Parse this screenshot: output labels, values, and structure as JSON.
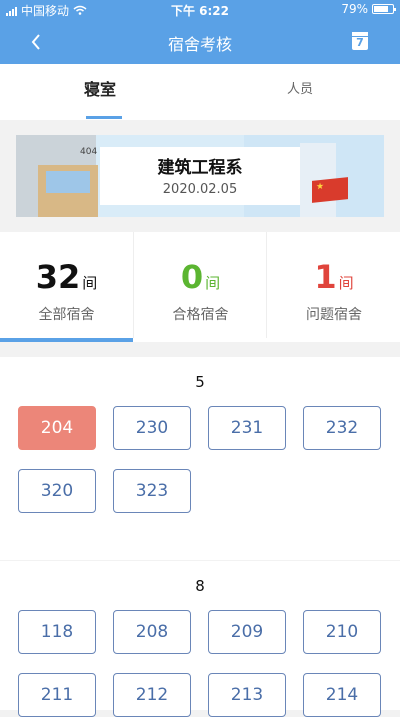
{
  "status_bar": {
    "carrier": "中国移动",
    "time": "下午 6:22",
    "battery": "79%",
    "battery_level": 0.79
  },
  "nav": {
    "title": "宿舍考核",
    "back_icon": "chevron-left-icon",
    "calendar_day": "7"
  },
  "tabs": [
    {
      "label": "寝室",
      "active": true
    },
    {
      "label": "人员",
      "active": false
    }
  ],
  "banner": {
    "department": "建筑工程系",
    "date": "2020.02.05",
    "sign_text": "404"
  },
  "stats": [
    {
      "value": "32",
      "unit": "间",
      "label": "全部宿舍",
      "color": "#111111"
    },
    {
      "value": "0",
      "unit": "间",
      "label": "合格宿舍",
      "color": "#5bb531"
    },
    {
      "value": "1",
      "unit": "间",
      "label": "问题宿舍",
      "color": "#e0443c"
    }
  ],
  "colors": {
    "accent": "#5aa1e6",
    "problem_room": "#ec8679",
    "room_border": "#6a86b8"
  },
  "sections": [
    {
      "title": "5",
      "rooms": [
        {
          "number": "204",
          "status": "problem"
        },
        {
          "number": "230",
          "status": "normal"
        },
        {
          "number": "231",
          "status": "normal"
        },
        {
          "number": "232",
          "status": "normal"
        },
        {
          "number": "320",
          "status": "normal"
        },
        {
          "number": "323",
          "status": "normal"
        }
      ]
    },
    {
      "title": "8",
      "rooms": [
        {
          "number": "118",
          "status": "normal"
        },
        {
          "number": "208",
          "status": "normal"
        },
        {
          "number": "209",
          "status": "normal"
        },
        {
          "number": "210",
          "status": "normal"
        },
        {
          "number": "211",
          "status": "normal"
        },
        {
          "number": "212",
          "status": "normal"
        },
        {
          "number": "213",
          "status": "normal"
        },
        {
          "number": "214",
          "status": "normal"
        }
      ]
    }
  ]
}
